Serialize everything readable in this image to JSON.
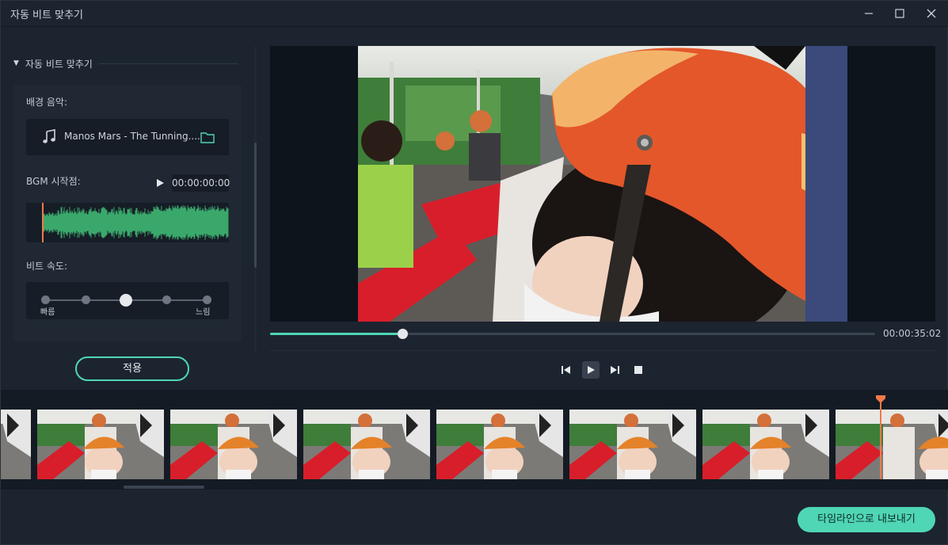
{
  "window": {
    "title": "자동 비트 맞추기",
    "minimize_icon": "minimize-icon",
    "maximize_icon": "maximize-icon",
    "close_icon": "close-icon"
  },
  "panel": {
    "section_title": "자동 비트 맞추기",
    "background_music_label": "배경 음악:",
    "music_name": "Manos Mars - The Tunning....",
    "bgm_start_label": "BGM 시작점:",
    "bgm_start_time": "00:00:00:00",
    "beat_speed_label": "비트 속도:",
    "speed_fast": "빠름",
    "speed_slow": "느림",
    "speed_levels": 5,
    "speed_selected_index": 2,
    "apply_label": "적용"
  },
  "preview": {
    "duration": "00:00:35:02",
    "progress": 0.219
  },
  "controls": {
    "prev_icon": "step-back-icon",
    "play_icon": "play-icon",
    "next_icon": "step-forward-icon",
    "stop_icon": "stop-icon"
  },
  "export": {
    "label": "타임라인으로 내보내기"
  },
  "colors": {
    "accent": "#4fd6b4",
    "playhead": "#f2784b",
    "waveform": "#3aa86b",
    "background": "#1c2430"
  }
}
